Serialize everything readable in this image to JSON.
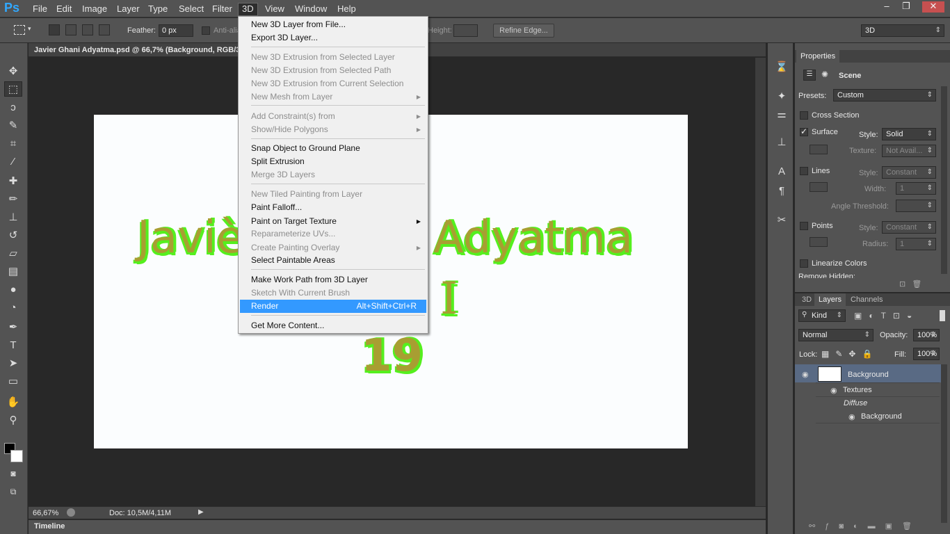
{
  "app": {
    "logo": "Ps"
  },
  "menubar": {
    "items": [
      "File",
      "Edit",
      "Image",
      "Layer",
      "Type",
      "Select",
      "Filter",
      "3D",
      "View",
      "Window",
      "Help"
    ],
    "active": "3D",
    "window_controls": [
      "–",
      "❐",
      "✕"
    ]
  },
  "options": {
    "feather_label": "Feather:",
    "feather_value": "0 px",
    "anti_alias_label": "Anti-alias",
    "height_label": "Height:",
    "refine_edge": "Refine Edge...",
    "workspace": "3D"
  },
  "document": {
    "tab_title": "Javier Ghani Adyatma.psd @ 66,7% (Background, RGB/3",
    "canvas_text_line1_left": "Javiè",
    "canvas_text_line1_right": "Adyatma",
    "canvas_text_line2": "I",
    "canvas_text_line3": "19",
    "zoom": "66,67%",
    "doc_size": "Doc: 10,5M/4,11M",
    "timeline_label": "Timeline"
  },
  "menu3d": {
    "items": [
      {
        "label": "New 3D Layer from File...",
        "enabled": true
      },
      {
        "label": "Export 3D Layer...",
        "enabled": true
      },
      {
        "label": "New 3D Extrusion from Selected Layer",
        "enabled": false
      },
      {
        "label": "New 3D Extrusion from Selected Path",
        "enabled": false
      },
      {
        "label": "New 3D Extrusion from Current Selection",
        "enabled": false
      },
      {
        "label": "New Mesh from Layer",
        "enabled": false,
        "submenu": true
      },
      {
        "label": "Add Constraint(s) from",
        "enabled": false,
        "submenu": true
      },
      {
        "label": "Show/Hide Polygons",
        "enabled": false,
        "submenu": true
      },
      {
        "label": "Snap Object to Ground Plane",
        "enabled": true
      },
      {
        "label": "Split Extrusion",
        "enabled": true
      },
      {
        "label": "Merge 3D Layers",
        "enabled": false
      },
      {
        "label": "New Tiled Painting from Layer",
        "enabled": false
      },
      {
        "label": "Paint Falloff...",
        "enabled": true
      },
      {
        "label": "Paint on Target Texture",
        "enabled": true,
        "submenu": true
      },
      {
        "label": "Reparameterize UVs...",
        "enabled": false
      },
      {
        "label": "Create Painting Overlay",
        "enabled": false,
        "submenu": true
      },
      {
        "label": "Select Paintable Areas",
        "enabled": true
      },
      {
        "label": "Make Work Path from 3D Layer",
        "enabled": true
      },
      {
        "label": "Sketch With Current Brush",
        "enabled": false
      },
      {
        "label": "Render",
        "enabled": true,
        "shortcut": "Alt+Shift+Ctrl+R",
        "highlighted": true
      },
      {
        "label": "Get More Content...",
        "enabled": true
      }
    ]
  },
  "properties": {
    "tab": "Properties",
    "scene_label": "Scene",
    "presets_label": "Presets:",
    "presets_value": "Custom",
    "cross_section": "Cross Section",
    "surface": "Surface",
    "style_label": "Style:",
    "surface_style": "Solid",
    "texture_label": "Texture:",
    "texture_value": "Not Avail...",
    "lines": "Lines",
    "lines_style": "Constant",
    "width_label": "Width:",
    "width_value": "1",
    "angle_label": "Angle Threshold:",
    "points": "Points",
    "points_style": "Constant",
    "radius_label": "Radius:",
    "radius_value": "1",
    "linearize": "Linearize Colors",
    "remove_hidden": "Remove Hidden:"
  },
  "layers": {
    "tabs": [
      "3D",
      "Layers",
      "Channels"
    ],
    "active_tab": "Layers",
    "kind_label": "Kind",
    "blend_mode": "Normal",
    "opacity_label": "Opacity:",
    "opacity": "100%",
    "lock_label": "Lock:",
    "fill_label": "Fill:",
    "fill": "100%",
    "rows": {
      "layer_name": "Background",
      "textures": "Textures",
      "diffuse": "Diffuse",
      "texture_name": "Background"
    }
  }
}
